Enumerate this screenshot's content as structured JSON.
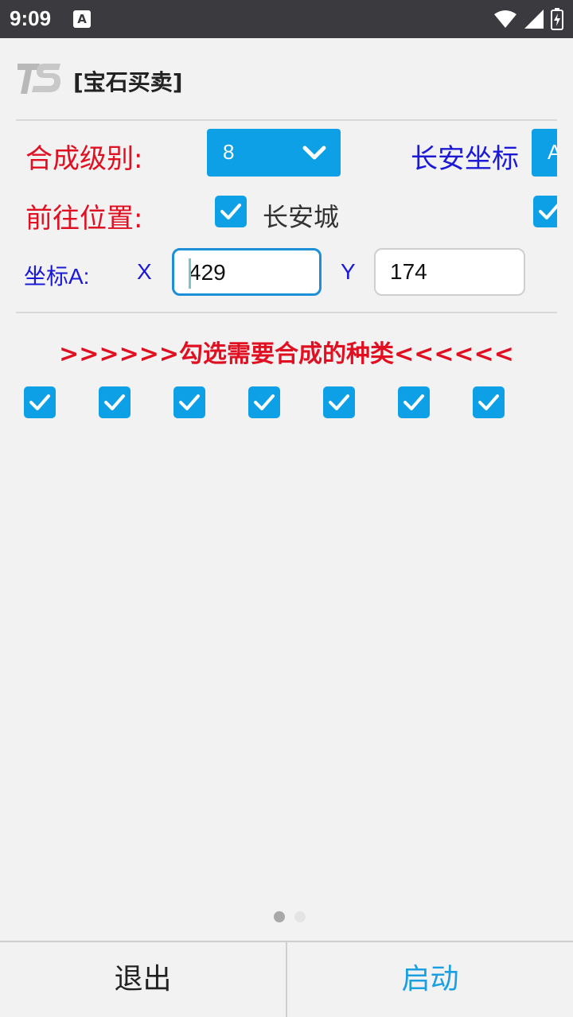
{
  "status_bar": {
    "time": "9:09",
    "notification_letter": "A"
  },
  "header": {
    "logo_text": "TS",
    "title": "[宝石买卖]"
  },
  "form": {
    "level_label": "合成级别:",
    "level_value": "8",
    "changan_coord_label": "长安坐标",
    "changan_coord_value": "A",
    "goto_label": "前往位置:",
    "goto_option_label": "长安城",
    "goto_option_checked": true,
    "coord_a_label": "坐标A:",
    "x_label": "X",
    "x_value": "429",
    "y_label": "Y",
    "y_value": "174"
  },
  "instruction": ">>>>>>勾选需要合成的种类<<<<<<",
  "gem_checkboxes": [
    true,
    true,
    true,
    true,
    true,
    true,
    true
  ],
  "pager": {
    "pages": 2,
    "active": 1
  },
  "bottom_bar": {
    "exit_label": "退出",
    "start_label": "启动"
  },
  "colors": {
    "accent_blue": "#0ea0e6",
    "label_red": "#e01022",
    "label_blue": "#1b19d6",
    "start_text": "#1aa0e0",
    "background": "#f2f2f2"
  }
}
